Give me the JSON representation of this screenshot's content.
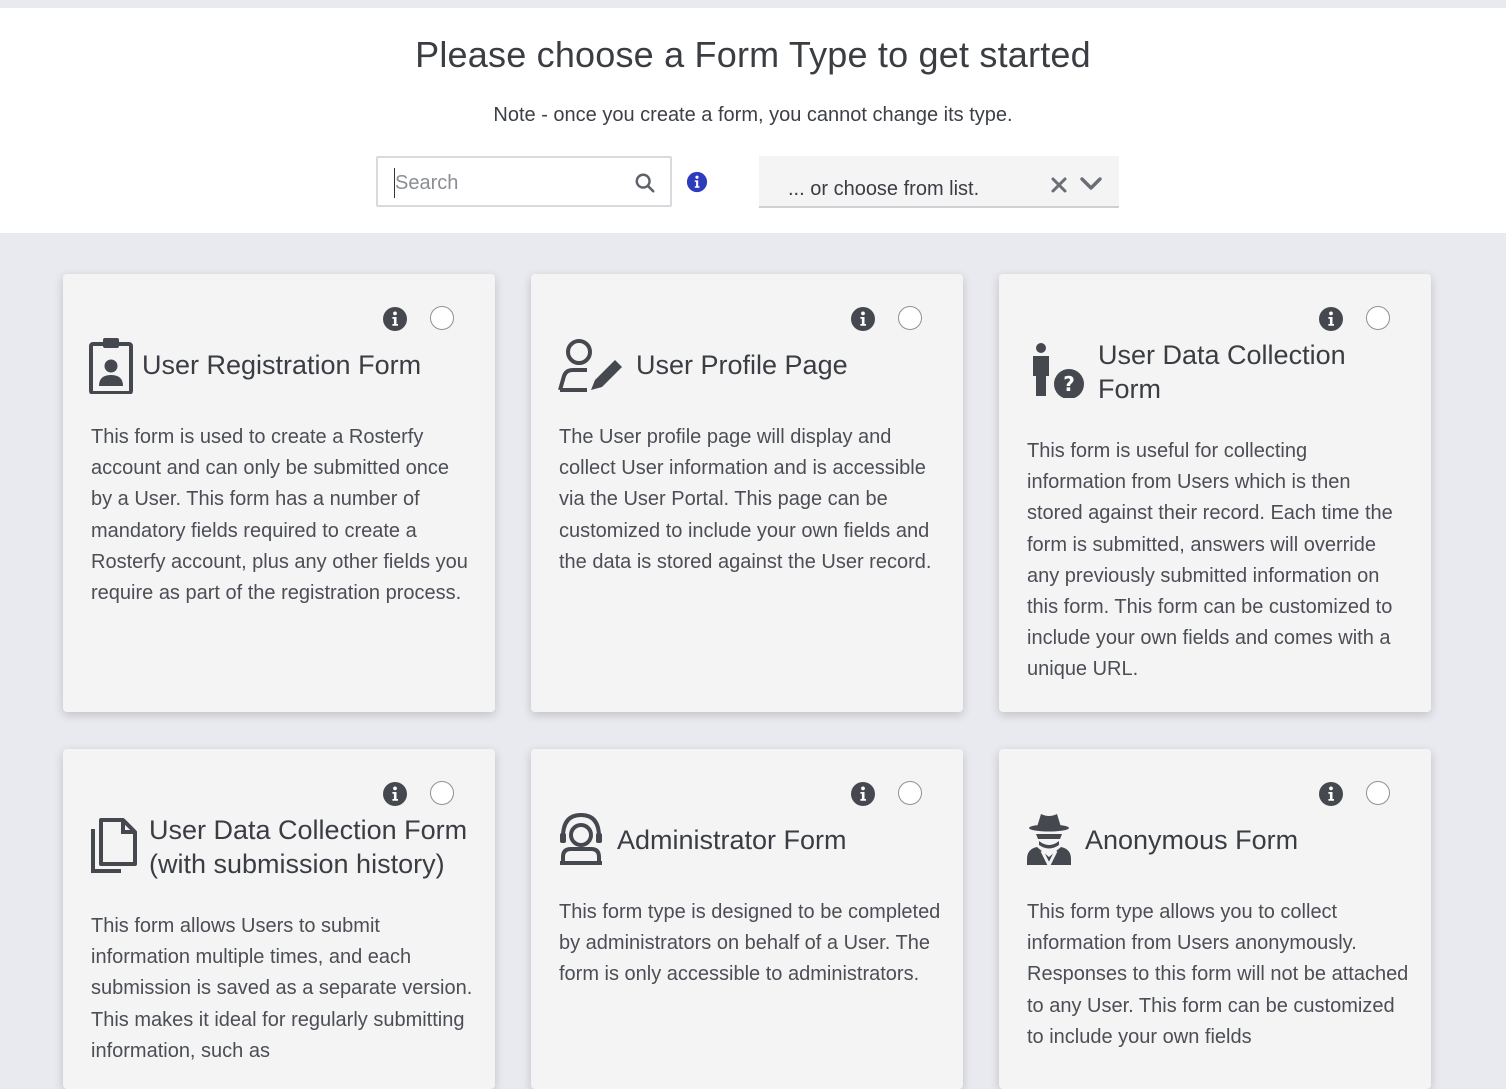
{
  "header": {
    "title": "Please choose a Form Type to get started",
    "note": "Note - once you create a form, you cannot change its type."
  },
  "search": {
    "placeholder": "Search",
    "value": ""
  },
  "select": {
    "placeholder": "... or choose from list."
  },
  "colors": {
    "accent": "#2f3bbd",
    "card_bg": "#f4f4f5",
    "page_bg": "#e9eaef"
  },
  "cards": [
    {
      "title": "User Registration Form",
      "icon": "id-badge-icon",
      "description": "This form is used to create a Rosterfy account and can only be submitted once by a User. This form has a number of mandatory fields required to create a Rosterfy account, plus any other fields you require as part of the registration process."
    },
    {
      "title": "User Profile Page",
      "icon": "user-edit-icon",
      "description": "The User profile page will display and collect User information and is accessible via the User Portal. This page can be customized to include your own fields and the data is stored against the User record."
    },
    {
      "title": "User Data Collection Form",
      "icon": "user-question-icon",
      "description": "This form is useful for collecting information from Users which is then stored against their record. Each time the form is submitted, answers will override any previously submitted information on this form. This form can be customized to include your own fields and comes with a unique URL."
    },
    {
      "title": "User Data Collection Form (with submission history)",
      "icon": "copy-icon",
      "description": "This form allows Users to submit information multiple times, and each submission is saved as a separate version. This makes it ideal for regularly submitting information, such as"
    },
    {
      "title": "Administrator Form",
      "icon": "user-headset-icon",
      "description": "This form type is designed to be completed by administrators on behalf of a User. The form is only accessible to administrators."
    },
    {
      "title": "Anonymous Form",
      "icon": "user-secret-icon",
      "description": "This form type allows you to collect information from Users anonymously. Responses to this form will not be attached to any User. This form can be customized to include your own fields"
    }
  ]
}
